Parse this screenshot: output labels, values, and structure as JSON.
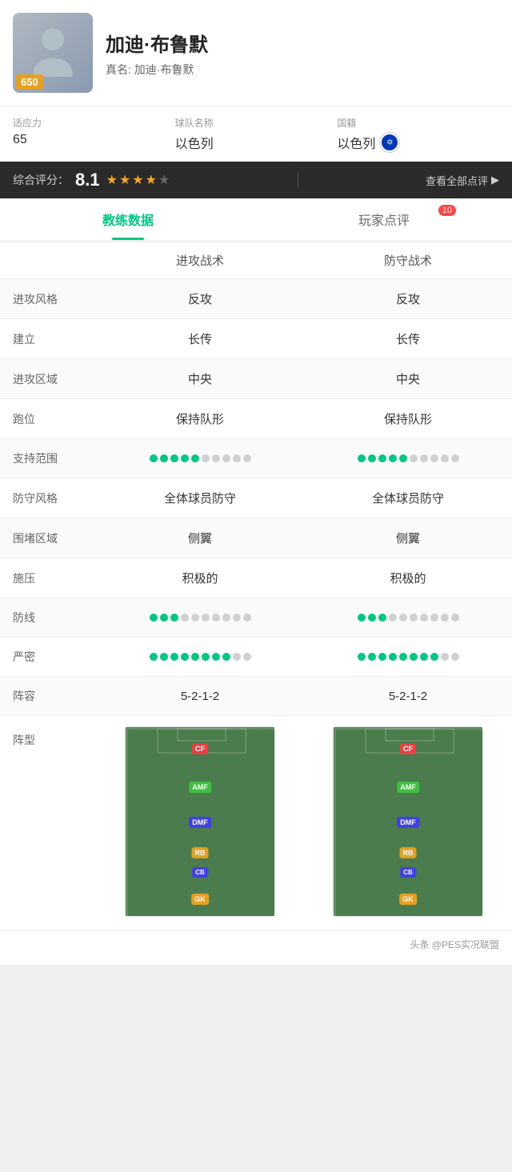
{
  "player": {
    "name": "加迪·布鲁默",
    "real_name_label": "真名:",
    "real_name": "加迪·布鲁默",
    "badge": "650"
  },
  "stats": {
    "adaptability_label": "适应力",
    "adaptability_value": "65",
    "team_label": "球队名称",
    "team_value": "以色列",
    "nationality_label": "国籍",
    "nationality_value": "以色列"
  },
  "rating": {
    "label": "综合评分：",
    "score": "8.1",
    "stars": [
      true,
      true,
      true,
      true,
      false
    ],
    "view_all": "查看全部点评",
    "divider": "▶"
  },
  "tabs": {
    "coach_data": "教练数据",
    "player_review": "玩家点评",
    "review_badge": "10"
  },
  "table": {
    "col_attack": "进攻战术",
    "col_defense": "防守战术",
    "rows": [
      {
        "label": "进攻风格",
        "attack": "反攻",
        "defense": "反攻",
        "type": "text"
      },
      {
        "label": "建立",
        "attack": "长传",
        "defense": "长传",
        "type": "text"
      },
      {
        "label": "进攻区域",
        "attack": "中央",
        "defense": "中央",
        "type": "text"
      },
      {
        "label": "跑位",
        "attack": "保持队形",
        "defense": "保持队形",
        "type": "text"
      },
      {
        "label": "支持范围",
        "attack": "",
        "defense": "",
        "type": "progress",
        "attack_val": 5,
        "defense_val": 5,
        "total": 10
      },
      {
        "label": "防守风格",
        "attack": "全体球员防守",
        "defense": "全体球员防守",
        "type": "text"
      },
      {
        "label": "围堵区域",
        "attack": "侧翼",
        "defense": "侧翼",
        "type": "text"
      },
      {
        "label": "施压",
        "attack": "积极的",
        "defense": "积极的",
        "type": "text"
      },
      {
        "label": "防线",
        "attack": "",
        "defense": "",
        "type": "progress",
        "attack_val": 3,
        "defense_val": 3,
        "total": 10
      },
      {
        "label": "严密",
        "attack": "",
        "defense": "",
        "type": "progress",
        "attack_val": 8,
        "defense_val": 8,
        "total": 10
      },
      {
        "label": "阵容",
        "attack": "5-2-1-2",
        "defense": "5-2-1-2",
        "type": "text"
      }
    ]
  },
  "formation_row_label": "阵型",
  "watermark": "头条 @PES实况联盟"
}
